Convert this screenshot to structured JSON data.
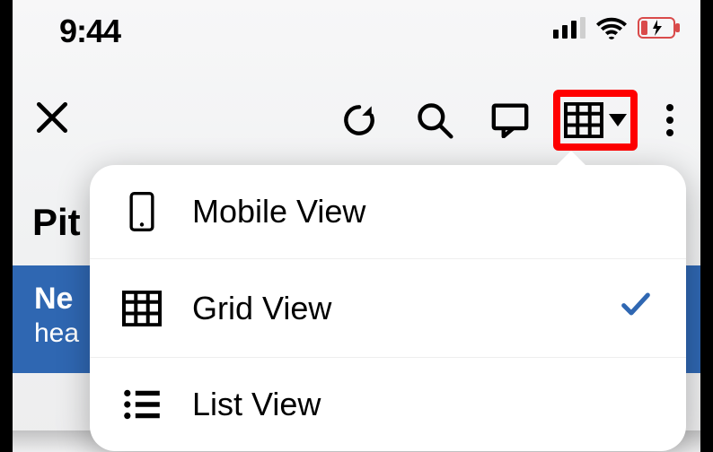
{
  "statusbar": {
    "time": "9:44"
  },
  "page": {
    "title_fragment": "Pit",
    "banner_line1_fragment": "Ne",
    "banner_line2_fragment": "hea"
  },
  "view_menu": {
    "items": [
      {
        "label": "Mobile View",
        "icon": "mobile-icon",
        "selected": false
      },
      {
        "label": "Grid View",
        "icon": "grid-icon",
        "selected": true
      },
      {
        "label": "List View",
        "icon": "list-icon",
        "selected": false
      }
    ]
  }
}
